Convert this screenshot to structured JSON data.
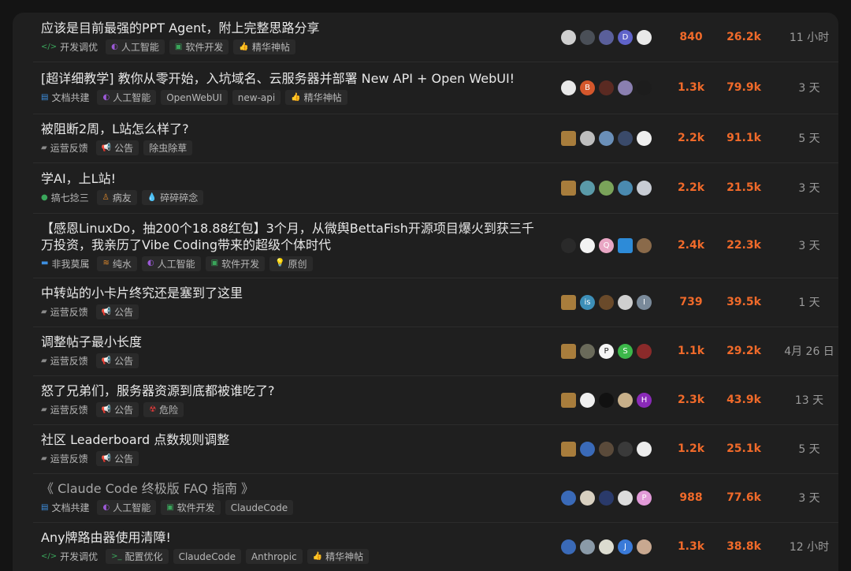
{
  "colors": {
    "accent_number": "#f06a2a",
    "background": "#1f1f1f",
    "tag_bg": "#2a2a2a"
  },
  "topics": [
    {
      "title": "应该是目前最强的PPT Agent，附上完整思路分享",
      "visited": false,
      "tags": [
        {
          "icon": "code-icon",
          "glyph": "</>",
          "color": "#3aa65b",
          "label": "开发调优",
          "plain": true
        },
        {
          "icon": "ai-icon",
          "glyph": "◐",
          "color": "#9b59d6",
          "label": "人工智能"
        },
        {
          "icon": "software-icon",
          "glyph": "▣",
          "color": "#3aa65b",
          "label": "软件开发"
        },
        {
          "icon": "thumbs-up-icon",
          "glyph": "👍",
          "color": "#3d8fe0",
          "label": "精华神帖"
        }
      ],
      "avatars": [
        {
          "c": "#cfcfcf",
          "t": ""
        },
        {
          "c": "#4a4f57",
          "t": ""
        },
        {
          "c": "#5a5f9a",
          "t": ""
        },
        {
          "c": "#5f63c9",
          "t": "D"
        },
        {
          "c": "#e9e9e9",
          "t": ""
        }
      ],
      "replies": "840",
      "views": "26.2k",
      "activity": "11 小时"
    },
    {
      "title": "[超详细教学] 教你从零开始，入坑域名、云服务器并部署 New API + Open WebUI!",
      "visited": false,
      "tags": [
        {
          "icon": "doc-icon",
          "glyph": "▤",
          "color": "#3d8fe0",
          "label": "文档共建",
          "plain": true
        },
        {
          "icon": "ai-icon",
          "glyph": "◐",
          "color": "#9b59d6",
          "label": "人工智能"
        },
        {
          "icon": "",
          "glyph": "",
          "color": "",
          "label": "OpenWebUI"
        },
        {
          "icon": "",
          "glyph": "",
          "color": "",
          "label": "new-api"
        },
        {
          "icon": "thumbs-up-icon",
          "glyph": "👍",
          "color": "#3d8fe0",
          "label": "精华神帖"
        }
      ],
      "avatars": [
        {
          "c": "#e8e8e8",
          "t": ""
        },
        {
          "c": "#d4572c",
          "t": "B"
        },
        {
          "c": "#5a2a22",
          "t": ""
        },
        {
          "c": "#8a7fb0",
          "t": ""
        },
        {
          "c": "#1d1d1d",
          "t": ""
        }
      ],
      "replies": "1.3k",
      "views": "79.9k",
      "activity": "3 天"
    },
    {
      "title": "被阻断2周，L站怎么样了?",
      "visited": false,
      "tags": [
        {
          "icon": "chat-icon",
          "glyph": "▰",
          "color": "#8a8a8a",
          "label": "运营反馈",
          "plain": true
        },
        {
          "icon": "megaphone-icon",
          "glyph": "📢",
          "color": "#3d8fe0",
          "label": "公告"
        },
        {
          "icon": "",
          "glyph": "",
          "color": "",
          "label": "除虫除草"
        }
      ],
      "avatars": [
        {
          "c": "#a87d3c",
          "t": "",
          "sq": true
        },
        {
          "c": "#bdbdbd",
          "t": ""
        },
        {
          "c": "#6a8fb8",
          "t": ""
        },
        {
          "c": "#3a4a6a",
          "t": ""
        },
        {
          "c": "#efefef",
          "t": ""
        }
      ],
      "replies": "2.2k",
      "views": "91.1k",
      "activity": "5 天"
    },
    {
      "title": "学AI，上L站!",
      "visited": false,
      "tags": [
        {
          "icon": "drop-icon",
          "glyph": "●",
          "color": "#3aa65b",
          "label": "搞七捻三",
          "plain": true
        },
        {
          "icon": "person-icon",
          "glyph": "♙",
          "color": "#e08a2c",
          "label": "病友"
        },
        {
          "icon": "water-drop-icon",
          "glyph": "💧",
          "color": "#3d8fe0",
          "label": "碎碎碎念"
        }
      ],
      "avatars": [
        {
          "c": "#a87d3c",
          "t": "",
          "sq": true
        },
        {
          "c": "#5a9aa8",
          "t": ""
        },
        {
          "c": "#7aa35a",
          "t": ""
        },
        {
          "c": "#4a8ab0",
          "t": ""
        },
        {
          "c": "#c8ccd4",
          "t": ""
        }
      ],
      "replies": "2.2k",
      "views": "21.5k",
      "activity": "3 天"
    },
    {
      "title": "【感恩LinuxDo，抽200个18.88红包】3个月，从微舆BettaFish开源项目爆火到获三千万投资，我亲历了Vibe Coding带来的超级个体时代",
      "visited": false,
      "tags": [
        {
          "icon": "sofa-icon",
          "glyph": "▬",
          "color": "#3d8fe0",
          "label": "非我莫属",
          "plain": true
        },
        {
          "icon": "water-icon",
          "glyph": "≋",
          "color": "#e08a2c",
          "label": "纯水"
        },
        {
          "icon": "ai-icon",
          "glyph": "◐",
          "color": "#9b59d6",
          "label": "人工智能"
        },
        {
          "icon": "software-icon",
          "glyph": "▣",
          "color": "#3aa65b",
          "label": "软件开发"
        },
        {
          "icon": "bulb-icon",
          "glyph": "💡",
          "color": "#3d8fe0",
          "label": "原创"
        }
      ],
      "avatars": [
        {
          "c": "#2a2a2a",
          "t": ""
        },
        {
          "c": "#f2f2f2",
          "t": ""
        },
        {
          "c": "#e9a6c4",
          "t": "Q"
        },
        {
          "c": "#2d8bd8",
          "t": "",
          "sq": true
        },
        {
          "c": "#8a6a4a",
          "t": ""
        }
      ],
      "replies": "2.4k",
      "views": "22.3k",
      "activity": "3 天"
    },
    {
      "title": "中转站的小卡片终究还是塞到了这里",
      "visited": false,
      "tags": [
        {
          "icon": "chat-icon",
          "glyph": "▰",
          "color": "#8a8a8a",
          "label": "运营反馈",
          "plain": true
        },
        {
          "icon": "megaphone-icon",
          "glyph": "📢",
          "color": "#3d8fe0",
          "label": "公告"
        }
      ],
      "avatars": [
        {
          "c": "#a87d3c",
          "t": "",
          "sq": true
        },
        {
          "c": "#3d8fb8",
          "t": "is"
        },
        {
          "c": "#6a4a2a",
          "t": ""
        },
        {
          "c": "#cfcfcf",
          "t": ""
        },
        {
          "c": "#7a8a9a",
          "t": "I"
        }
      ],
      "replies": "739",
      "views": "39.5k",
      "activity": "1 天"
    },
    {
      "title": "调整帖子最小长度",
      "visited": false,
      "tags": [
        {
          "icon": "chat-icon",
          "glyph": "▰",
          "color": "#8a8a8a",
          "label": "运营反馈",
          "plain": true
        },
        {
          "icon": "megaphone-icon",
          "glyph": "📢",
          "color": "#3d8fe0",
          "label": "公告"
        }
      ],
      "avatars": [
        {
          "c": "#a87d3c",
          "t": "",
          "sq": true
        },
        {
          "c": "#6a6a5a",
          "t": ""
        },
        {
          "c": "#f5f5f5",
          "t": "P"
        },
        {
          "c": "#3cb84a",
          "t": "S"
        },
        {
          "c": "#8a2a2a",
          "t": ""
        }
      ],
      "replies": "1.1k",
      "views": "29.2k",
      "activity": "4月 26 日"
    },
    {
      "title": "怒了兄弟们，服务器资源到底都被谁吃了?",
      "visited": false,
      "tags": [
        {
          "icon": "chat-icon",
          "glyph": "▰",
          "color": "#8a8a8a",
          "label": "运营反馈",
          "plain": true
        },
        {
          "icon": "megaphone-icon",
          "glyph": "📢",
          "color": "#3d8fe0",
          "label": "公告"
        },
        {
          "icon": "hazard-icon",
          "glyph": "☢",
          "color": "#e03a3a",
          "label": "危险"
        }
      ],
      "avatars": [
        {
          "c": "#a87d3c",
          "t": "",
          "sq": true
        },
        {
          "c": "#f0f0f0",
          "t": ""
        },
        {
          "c": "#111111",
          "t": ""
        },
        {
          "c": "#c8b08a",
          "t": ""
        },
        {
          "c": "#8a2ab8",
          "t": "H"
        }
      ],
      "replies": "2.3k",
      "views": "43.9k",
      "activity": "13 天"
    },
    {
      "title": "社区 Leaderboard 点数规则调整",
      "visited": false,
      "tags": [
        {
          "icon": "chat-icon",
          "glyph": "▰",
          "color": "#8a8a8a",
          "label": "运营反馈",
          "plain": true
        },
        {
          "icon": "megaphone-icon",
          "glyph": "📢",
          "color": "#3d8fe0",
          "label": "公告"
        }
      ],
      "avatars": [
        {
          "c": "#a87d3c",
          "t": "",
          "sq": true
        },
        {
          "c": "#3a6ab8",
          "t": ""
        },
        {
          "c": "#5a4a3a",
          "t": ""
        },
        {
          "c": "#3a3a3a",
          "t": ""
        },
        {
          "c": "#ececec",
          "t": ""
        }
      ],
      "replies": "1.2k",
      "views": "25.1k",
      "activity": "5 天"
    },
    {
      "title": "《 Claude Code 终极版 FAQ 指南 》",
      "visited": true,
      "tags": [
        {
          "icon": "doc-icon",
          "glyph": "▤",
          "color": "#3d8fe0",
          "label": "文档共建",
          "plain": true
        },
        {
          "icon": "ai-icon",
          "glyph": "◐",
          "color": "#9b59d6",
          "label": "人工智能"
        },
        {
          "icon": "software-icon",
          "glyph": "▣",
          "color": "#3aa65b",
          "label": "软件开发"
        },
        {
          "icon": "",
          "glyph": "",
          "color": "",
          "label": "ClaudeCode"
        }
      ],
      "avatars": [
        {
          "c": "#3a6ab8",
          "t": ""
        },
        {
          "c": "#d8d0c0",
          "t": ""
        },
        {
          "c": "#2a3a6a",
          "t": ""
        },
        {
          "c": "#dcdcdc",
          "t": ""
        },
        {
          "c": "#e29ad8",
          "t": "P"
        }
      ],
      "replies": "988",
      "views": "77.6k",
      "activity": "3 天"
    },
    {
      "title": "Any牌路由器使用清障!",
      "visited": false,
      "tags": [
        {
          "icon": "code-icon",
          "glyph": "</>",
          "color": "#3aa65b",
          "label": "开发调优",
          "plain": true
        },
        {
          "icon": "terminal-icon",
          "glyph": ">_",
          "color": "#3aa65b",
          "label": "配置优化"
        },
        {
          "icon": "",
          "glyph": "",
          "color": "",
          "label": "ClaudeCode"
        },
        {
          "icon": "",
          "glyph": "",
          "color": "",
          "label": "Anthropic"
        },
        {
          "icon": "thumbs-up-icon",
          "glyph": "👍",
          "color": "#3d8fe0",
          "label": "精华神帖"
        }
      ],
      "avatars": [
        {
          "c": "#3a6ab8",
          "t": ""
        },
        {
          "c": "#8a9aa8",
          "t": ""
        },
        {
          "c": "#dcdcd0",
          "t": ""
        },
        {
          "c": "#3a7ad8",
          "t": "J"
        },
        {
          "c": "#c8a890",
          "t": ""
        }
      ],
      "replies": "1.3k",
      "views": "38.8k",
      "activity": "12 小时"
    }
  ]
}
